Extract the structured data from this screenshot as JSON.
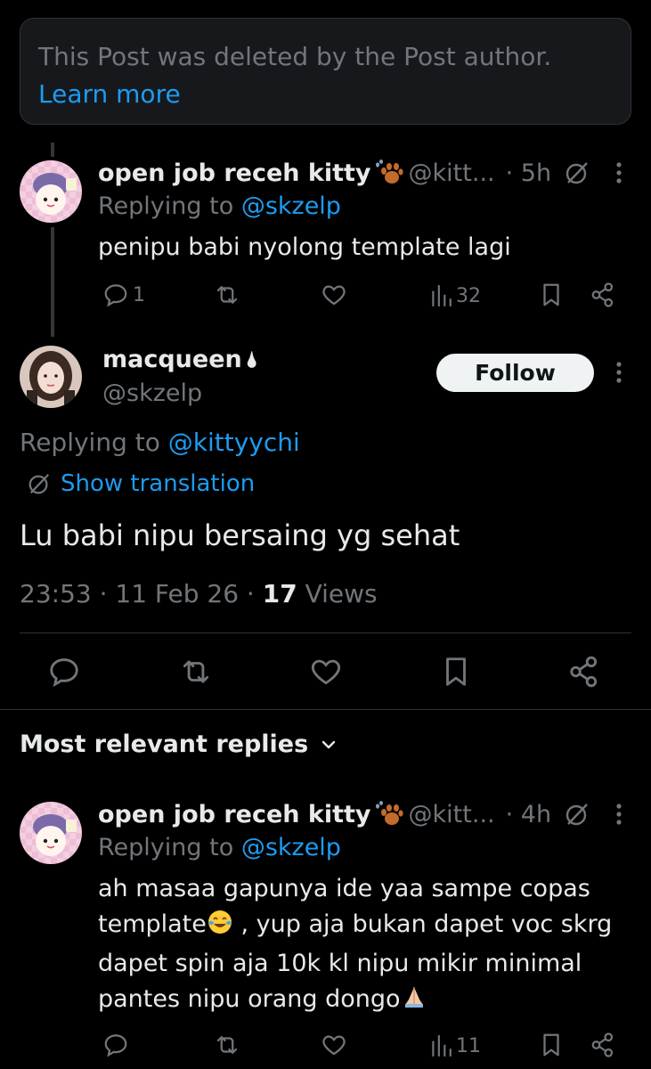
{
  "deleted_notice": {
    "text": "This Post was deleted by the Post author.",
    "link": "Learn more"
  },
  "reply1": {
    "name": "open job receh kitty",
    "handle": "@kitt...",
    "time": "· 5h",
    "replying_prefix": "Replying to ",
    "replying_to": "@skzelp",
    "text": "penipu babi nyolong template lagi",
    "views": "32",
    "replies": "1"
  },
  "main_post": {
    "name": "macqueen",
    "name_suffix": "🌢",
    "handle": "@skzelp",
    "follow_label": "Follow",
    "replying_prefix": "Replying to ",
    "replying_to": "@kittyychi",
    "show_translation": "Show translation",
    "text": "Lu babi nipu bersaing yg sehat",
    "time": "23:53 · 11 Feb 26 · ",
    "views_count": "17",
    "views_label": " Views"
  },
  "replies_header": {
    "label": "Most relevant replies"
  },
  "reply2": {
    "name": "open job receh kitty",
    "handle": "@kitt...",
    "time": "· 4h",
    "replying_prefix": "Replying to ",
    "replying_to": "@skzelp",
    "line1": "ah masaa gapunya ide yaa sampe copas",
    "line2a": "template",
    "line2b": " , yup aja bukan dapet voc skrg",
    "line3": "dapet spin aja 10k kl nipu mikir minimal",
    "line4": "pantes nipu orang dongo",
    "views": "11"
  },
  "colors": {
    "background": "#000000",
    "accent": "#1d9bf0",
    "muted": "#71767b",
    "text": "#e7e9ea",
    "border": "#2f3336"
  }
}
